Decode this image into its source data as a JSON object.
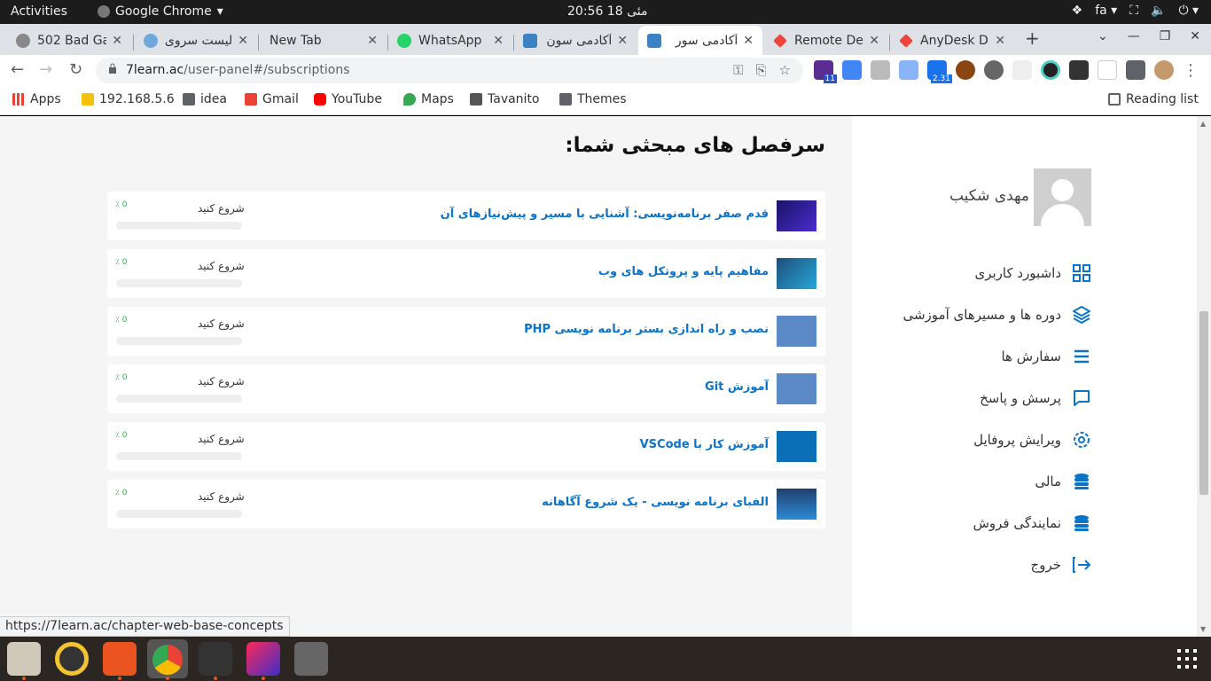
{
  "os": {
    "activities": "Activities",
    "app_menu": "Google Chrome",
    "clock": "20:56  مئی 18",
    "lang": "fa"
  },
  "tabs": [
    {
      "title": "502 Bad Ga",
      "active": false
    },
    {
      "title": "لیست سروی",
      "active": false
    },
    {
      "title": "New Tab",
      "active": false
    },
    {
      "title": "WhatsApp",
      "active": false
    },
    {
      "title": "آکادمی سون",
      "active": false
    },
    {
      "title": "آکادمی سور",
      "active": true
    },
    {
      "title": "Remote De",
      "active": false
    },
    {
      "title": "AnyDesk DE",
      "active": false
    }
  ],
  "address": {
    "host": "7learn.ac",
    "path": "/user-panel#/subscriptions"
  },
  "bookmarks": {
    "apps": "Apps",
    "ip": "192.168.5.6",
    "idea": "idea",
    "gmail": "Gmail",
    "youtube": "YouTube",
    "maps": "Maps",
    "tavanito": "Tavanito",
    "themes": "Themes",
    "reading_list": "Reading list"
  },
  "extension_badges": {
    "b1": "11",
    "b2": "2.31"
  },
  "sidebar": {
    "username": "مهدی شکیب",
    "items": [
      {
        "label": "داشبورد کاربری"
      },
      {
        "label": "دوره ها و مسیرهای آموزشی"
      },
      {
        "label": "سفارش ها"
      },
      {
        "label": "پرسش و پاسخ"
      },
      {
        "label": "ویرایش پروفایل"
      },
      {
        "label": "مالی"
      },
      {
        "label": "نمایندگی فروش"
      },
      {
        "label": "خروج"
      }
    ]
  },
  "main": {
    "title": "سرفصل های مبحثی شما:",
    "courses": [
      {
        "title": "قدم صفر برنامه‌نویسی: آشنایی با مسیر و پیش‌نیازهای آن",
        "start": "شروع کنید",
        "pct": "٪ 0",
        "progress": 0
      },
      {
        "title": "مفاهیم پایه و پروتکل های وب",
        "start": "شروع کنید",
        "pct": "٪ 0",
        "progress": 0
      },
      {
        "title": "نصب و راه اندازی بستر برنامه نویسی PHP",
        "start": "شروع کنید",
        "pct": "٪ 0",
        "progress": 0
      },
      {
        "title": "آموزش Git",
        "start": "شروع کنید",
        "pct": "٪ 0",
        "progress": 0
      },
      {
        "title": "آموزش کار با VSCode",
        "start": "شروع کنید",
        "pct": "٪ 0",
        "progress": 0
      },
      {
        "title": "الفبای برنامه نویسی - یک شروع آگاهانه",
        "start": "شروع کنید",
        "pct": "٪ 0",
        "progress": 0
      }
    ]
  },
  "status_url": "https://7learn.ac/chapter-web-base-concepts",
  "colors": {
    "accent": "#0b74c9",
    "progress_text": "#3aa757"
  }
}
